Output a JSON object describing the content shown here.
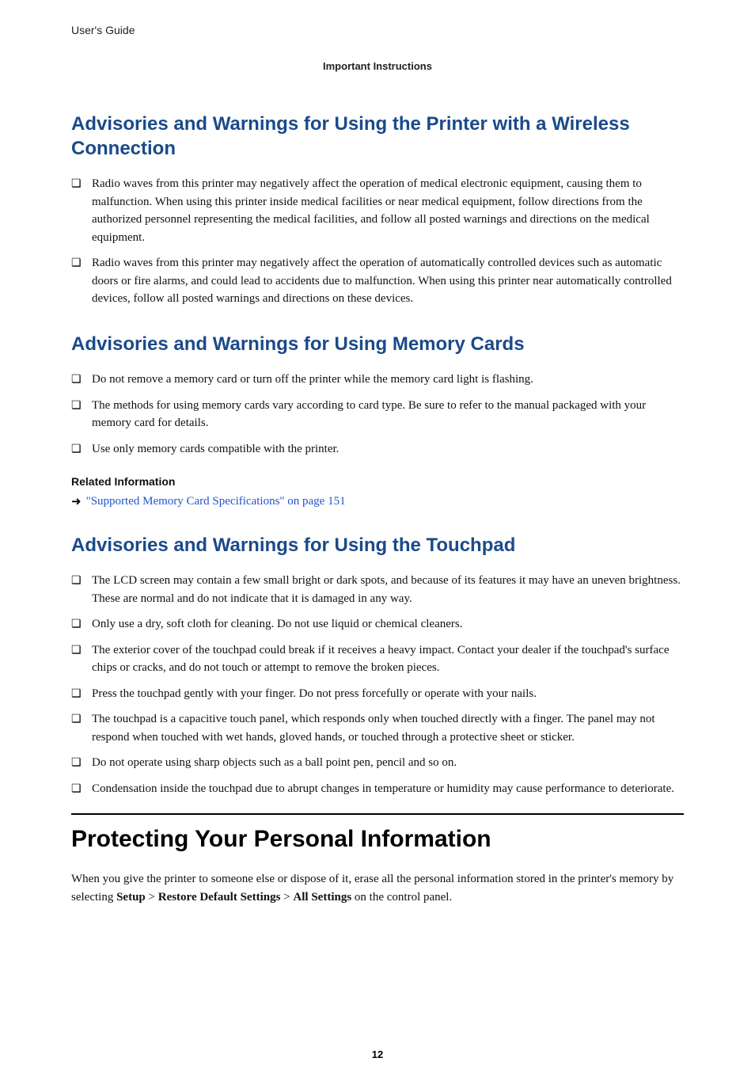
{
  "header": {
    "guide": "User's Guide",
    "instructions": "Important Instructions"
  },
  "sections": {
    "wireless": {
      "title": "Advisories and Warnings for Using the Printer with a Wireless Connection",
      "bullets": [
        "Radio waves from this printer may negatively affect the operation of medical electronic equipment, causing them to malfunction. When using this printer inside medical facilities or near medical equipment, follow directions from the authorized personnel representing the medical facilities, and follow all posted warnings and directions on the medical equipment.",
        "Radio waves from this printer may negatively affect the operation of automatically controlled devices such as automatic doors or fire alarms, and could lead to accidents due to malfunction. When using this printer near automatically controlled devices, follow all posted warnings and directions on these devices."
      ]
    },
    "memory": {
      "title": "Advisories and Warnings for Using Memory Cards",
      "bullets": [
        "Do not remove a memory card or turn off the printer while the memory card light is flashing.",
        "The methods for using memory cards vary according to card type. Be sure to refer to the manual packaged with your memory card for details.",
        "Use only memory cards compatible with the printer."
      ],
      "related_heading": "Related Information",
      "related_link": "\"Supported Memory Card Specifications\" on page 151"
    },
    "touchpad": {
      "title": "Advisories and Warnings for Using the Touchpad",
      "bullets": [
        "The LCD screen may contain a few small bright or dark spots, and because of its features it may have an uneven brightness. These are normal and do not indicate that it is damaged in any way.",
        "Only use a dry, soft cloth for cleaning. Do not use liquid or chemical cleaners.",
        "The exterior cover of the touchpad could break if it receives a heavy impact. Contact your dealer if the touchpad's surface chips or cracks, and do not touch or attempt to remove the broken pieces.",
        "Press the touchpad gently with your finger. Do not press forcefully or operate with your nails.",
        "The touchpad is a capacitive touch panel, which responds only when touched directly with a finger. The panel may not respond when touched with wet hands, gloved hands, or touched through a protective sheet or sticker.",
        "Do not operate using sharp objects such as a ball point pen, pencil and so on.",
        "Condensation inside the touchpad due to abrupt changes in temperature or humidity may cause performance to deteriorate."
      ]
    },
    "protecting": {
      "title": "Protecting Your Personal Information",
      "paragraph_parts": {
        "p1": "When you give the printer to someone else or dispose of it, erase all the personal information stored in the printer's memory by selecting ",
        "b1": "Setup",
        "sep1": " > ",
        "b2": "Restore Default Settings",
        "sep2": " > ",
        "b3": "All Settings",
        "p2": " on the control panel."
      }
    }
  },
  "page_number": "12"
}
